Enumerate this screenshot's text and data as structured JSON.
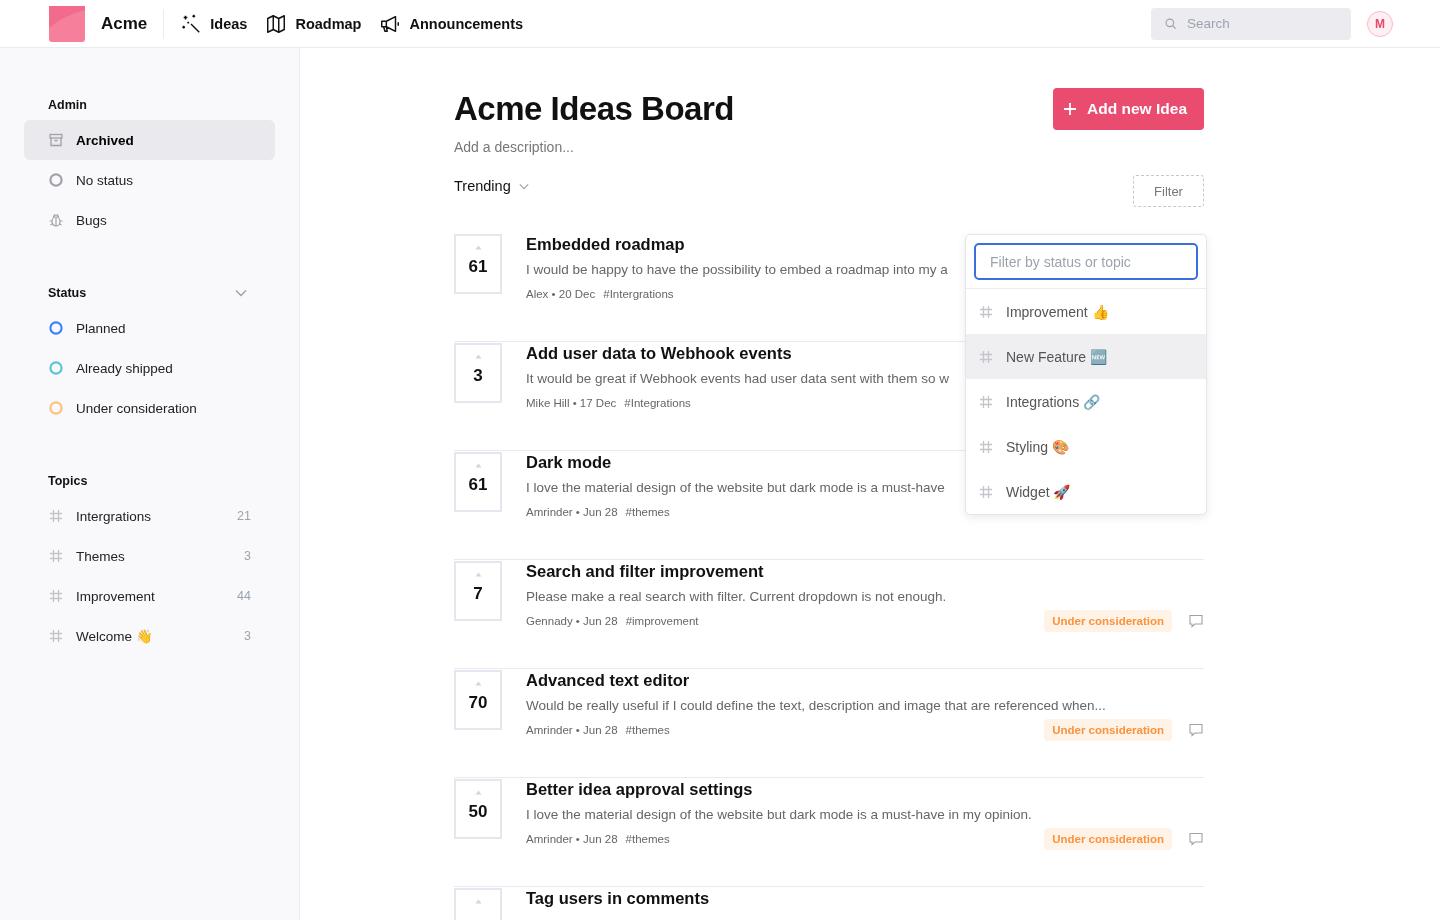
{
  "header": {
    "brand": "Acme",
    "nav": [
      {
        "kind": "ideas",
        "label": "Ideas"
      },
      {
        "kind": "roadmap",
        "label": "Roadmap"
      },
      {
        "kind": "announcements",
        "label": "Announcements"
      }
    ],
    "search": {
      "placeholder": "Search"
    },
    "avatar": "M"
  },
  "sidebar": {
    "sections": [
      {
        "title": "Admin",
        "collapsible": false,
        "items": [
          {
            "kind": "archive",
            "label": "Archived",
            "selected": true
          },
          {
            "kind": "status",
            "label": "No status",
            "color": "#a1a1aa",
            "selected": false
          },
          {
            "kind": "bug",
            "label": "Bugs",
            "selected": false
          }
        ]
      },
      {
        "title": "Status",
        "collapsible": true,
        "items": [
          {
            "kind": "status",
            "label": "Planned",
            "color": "#3b82f6",
            "selected": false
          },
          {
            "kind": "status",
            "label": "Already shipped",
            "color": "#56c6d6",
            "selected": false
          },
          {
            "kind": "status",
            "label": "Under consideration",
            "color": "#fbc27a",
            "selected": false
          }
        ]
      },
      {
        "title": "Topics",
        "collapsible": false,
        "items": [
          {
            "kind": "topic",
            "label": "Intergrations",
            "count": "21",
            "selected": false
          },
          {
            "kind": "topic",
            "label": "Themes",
            "count": "3",
            "selected": false
          },
          {
            "kind": "topic",
            "label": "Improvement",
            "count": "44",
            "selected": false
          },
          {
            "kind": "topic",
            "label": "Welcome 👋",
            "count": "3",
            "selected": false
          }
        ]
      }
    ]
  },
  "board": {
    "title": "Acme Ideas Board",
    "description_placeholder": "Add a description...",
    "add_button": "Add new Idea",
    "sort": "Trending",
    "filter_button": "Filter"
  },
  "ideas": [
    {
      "votes": "61",
      "title": "Embedded roadmap",
      "description": "I would be happy to have the possibility to embed a roadmap into my a",
      "byline": "Alex • 20 Dec",
      "tag": "#Intergrations"
    },
    {
      "votes": "3",
      "title": "Add user data to Webhook events",
      "description": "It would be great if Webhook events had user data sent with them so w",
      "byline": "Mike Hill • 17 Dec",
      "tag": "#Integrations"
    },
    {
      "votes": "61",
      "title": "Dark mode",
      "description": "I love the material design of the website but dark mode is a must-have",
      "byline": "Amrinder • Jun 28",
      "tag": "#themes"
    },
    {
      "votes": "7",
      "title": "Search and filter improvement",
      "description": "Please make a real search with filter.  Current dropdown is not enough.",
      "byline": "Gennady • Jun 28",
      "tag": "#improvement",
      "status": "Under consideration"
    },
    {
      "votes": "70",
      "title": "Advanced text editor",
      "description": "Would be really useful if I could define the text, description and image that are referenced when...",
      "byline": "Amrinder • Jun 28",
      "tag": "#themes",
      "status": "Under consideration"
    },
    {
      "votes": "50",
      "title": "Better idea approval settings",
      "description": "I love the material design of the website but dark mode is a must-have in my opinion.",
      "byline": "Amrinder • Jun 28",
      "tag": "#themes",
      "status": "Under consideration"
    },
    {
      "title": "Tag users in comments"
    }
  ],
  "filter_dropdown": {
    "placeholder": "Filter by status or topic",
    "options": [
      {
        "label": "Improvement 👍",
        "selected": false
      },
      {
        "label": "New Feature 🆕",
        "selected": true
      },
      {
        "label": "Integrations 🔗",
        "selected": false
      },
      {
        "label": "Styling 🎨",
        "selected": false
      },
      {
        "label": "Widget 🚀",
        "selected": false
      }
    ]
  }
}
